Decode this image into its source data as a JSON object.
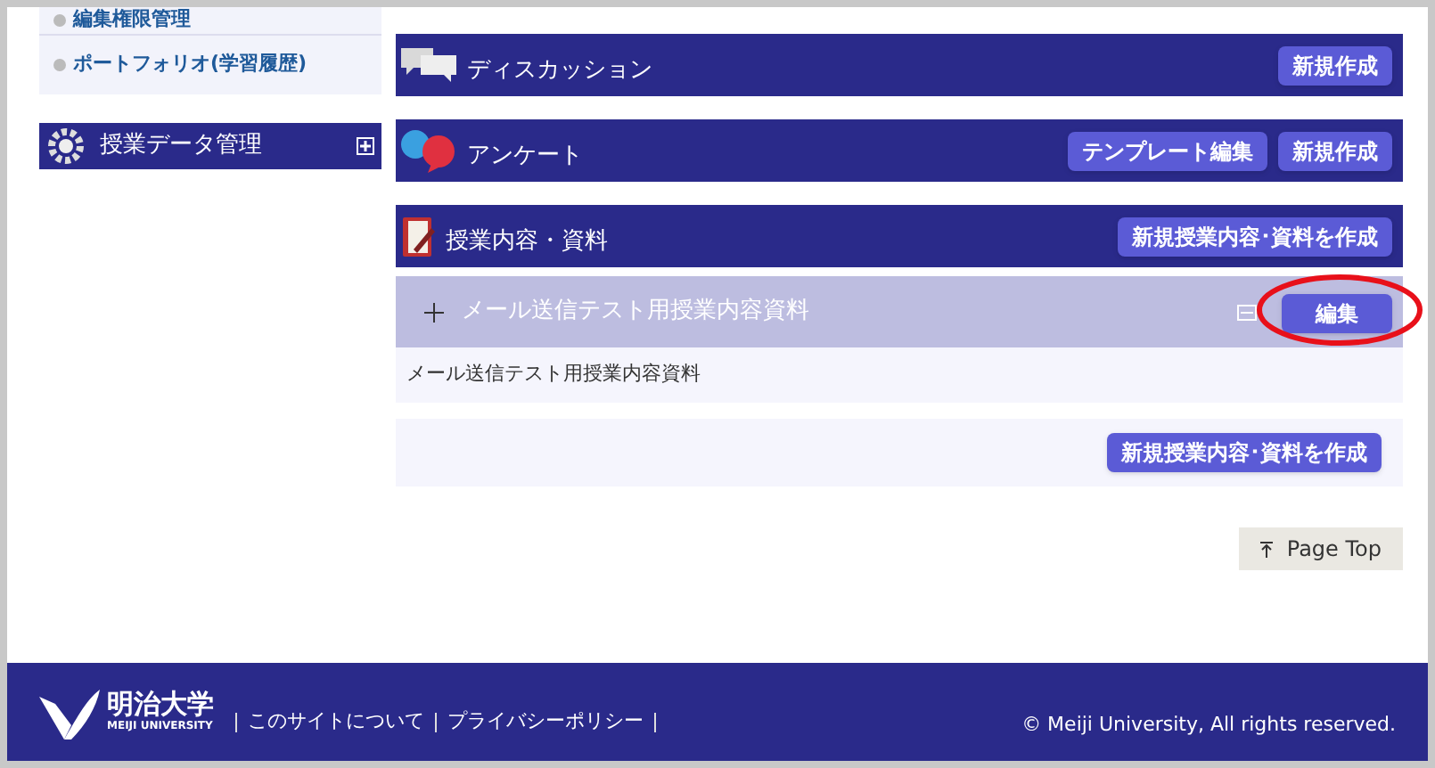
{
  "sidebar": {
    "items": [
      {
        "label": "編集権限管理"
      },
      {
        "label": "ポートフォリオ(学習履歴)"
      }
    ],
    "section": {
      "title": "授業データ管理",
      "expanded": false
    }
  },
  "sections": [
    {
      "kind": "discussion",
      "title": "ディスカッション",
      "buttons": [
        "新規作成"
      ]
    },
    {
      "kind": "survey",
      "title": "アンケート",
      "buttons": [
        "テンプレート編集",
        "新規作成"
      ]
    },
    {
      "kind": "materials",
      "title": "授業内容・資料",
      "buttons": [
        "新規授業内容･資料を作成"
      ],
      "items": [
        {
          "title": "メール送信テスト用授業内容資料",
          "expanded": true,
          "edit_button": "編集",
          "highlighted": true,
          "body": "メール送信テスト用授業内容資料"
        }
      ],
      "footer_button": "新規授業内容･資料を作成"
    }
  ],
  "page_top": "Page Top",
  "footer": {
    "logo_text": "明治大学",
    "logo_subtext": "MEIJI UNIVERSITY",
    "links": [
      "このサイトについて",
      "プライバシーポリシー"
    ],
    "copyright": "© Meiji University, All rights reserved."
  }
}
